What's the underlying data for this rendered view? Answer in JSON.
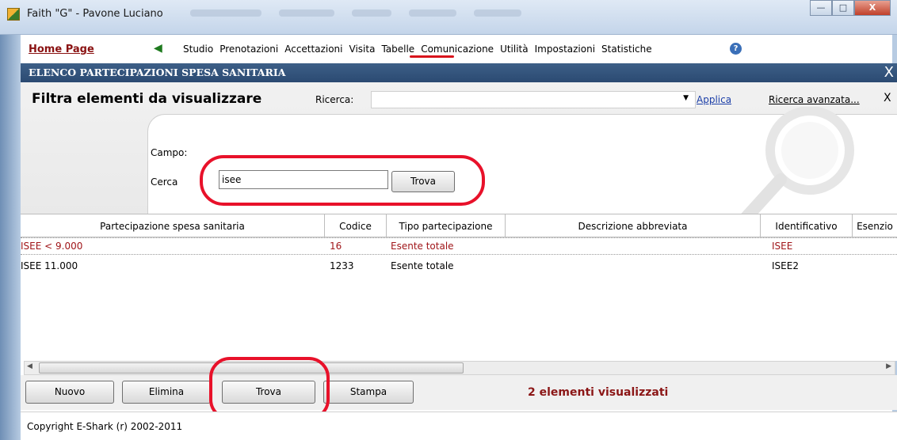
{
  "window": {
    "title": "Faith \"G\" - Pavone Luciano",
    "min_label": "—",
    "max_label": "□",
    "close_label": "X"
  },
  "menubar": {
    "home": "Home Page",
    "items": [
      "Studio",
      "Prenotazioni",
      "Accettazioni",
      "Visita",
      "Tabelle",
      "Comunicazione",
      "Utilità",
      "Impostazioni",
      "Statistiche"
    ],
    "help": "?"
  },
  "header": {
    "title": "ELENCO PARTECIPAZIONI SPESA SANITARIA",
    "close": "X"
  },
  "filter": {
    "title": "Filtra elementi da visualizzare",
    "ricerca_label": "Ricerca:",
    "ricerca_value": "",
    "applica": "Applica",
    "ricerca_avanzata": "Ricerca avanzata...",
    "close": "X",
    "campo_label": "Campo:",
    "cerca_label": "Cerca",
    "cerca_value": "isee",
    "trova_label": "Trova"
  },
  "table": {
    "columns": [
      "Partecipazione spesa sanitaria",
      "Codice",
      "Tipo partecipazione",
      "Descrizione abbreviata",
      "Identificativo",
      "Esenzio"
    ],
    "rows": [
      [
        "ISEE < 9.000",
        "16",
        "Esente totale",
        "",
        "ISEE",
        ""
      ],
      [
        "ISEE 11.000",
        "1233",
        "Esente totale",
        "",
        "ISEE2",
        ""
      ]
    ]
  },
  "buttons": {
    "nuovo": "Nuovo",
    "elimina": "Elimina",
    "trova": "Trova",
    "stampa": "Stampa"
  },
  "status": {
    "count_text": "2 elementi visualizzati"
  },
  "footer": {
    "copyright": "Copyright E-Shark (r) 2002-2011"
  },
  "colors": {
    "header_blue": "#2b4a72",
    "accent_red": "#e8112a",
    "row_selected_text": "#a0161a"
  }
}
